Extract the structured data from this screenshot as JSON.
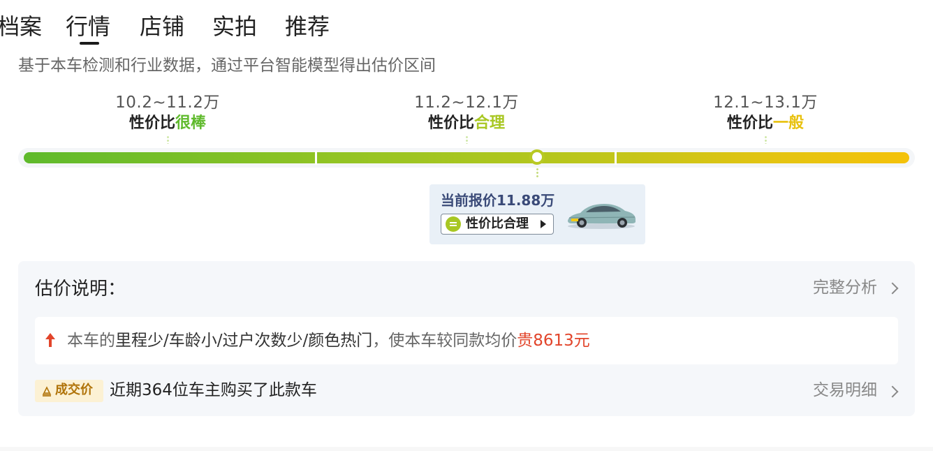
{
  "tabs": [
    {
      "label": "档案",
      "active": false
    },
    {
      "label": "行情",
      "active": true
    },
    {
      "label": "店铺",
      "active": false
    },
    {
      "label": "实拍",
      "active": false
    },
    {
      "label": "推荐",
      "active": false
    }
  ],
  "description": "基于本车检测和行业数据，通过平台智能模型得出估价区间",
  "ranges": [
    {
      "value": "10.2~11.2万",
      "label_prefix": "性价比",
      "label_rating": "很棒",
      "color": "#5fba2c"
    },
    {
      "value": "11.2~12.1万",
      "label_prefix": "性价比",
      "label_rating": "合理",
      "color": "#a8c722"
    },
    {
      "value": "12.1~13.1万",
      "label_prefix": "性价比",
      "label_rating": "一般",
      "color": "#e8c10e"
    }
  ],
  "current_price": {
    "text": "当前报价11.88万",
    "value_wan": 11.88,
    "badge": "性价比合理",
    "badge_icon": "equals-circle-icon",
    "car_image": "car-thumbnail"
  },
  "estimate": {
    "title": "估价说明：",
    "full_analysis_link": "完整分析",
    "reason": {
      "prefix": "本车的",
      "factors": "里程少/车龄小/过户次数少/颜色热门",
      "middle": "，使本车较同款均价",
      "highlight": "贵8613元"
    },
    "deal_tag": "成交价",
    "deal_text": "近期364位车主购买了此款车",
    "deal_link": "交易明细"
  },
  "colors": {
    "accent_green": "#5fba2c",
    "accent_yellow": "#f4c20a",
    "price_blue": "#3a4a78",
    "warning_red": "#e2452b",
    "deal_gold": "#b07309"
  }
}
